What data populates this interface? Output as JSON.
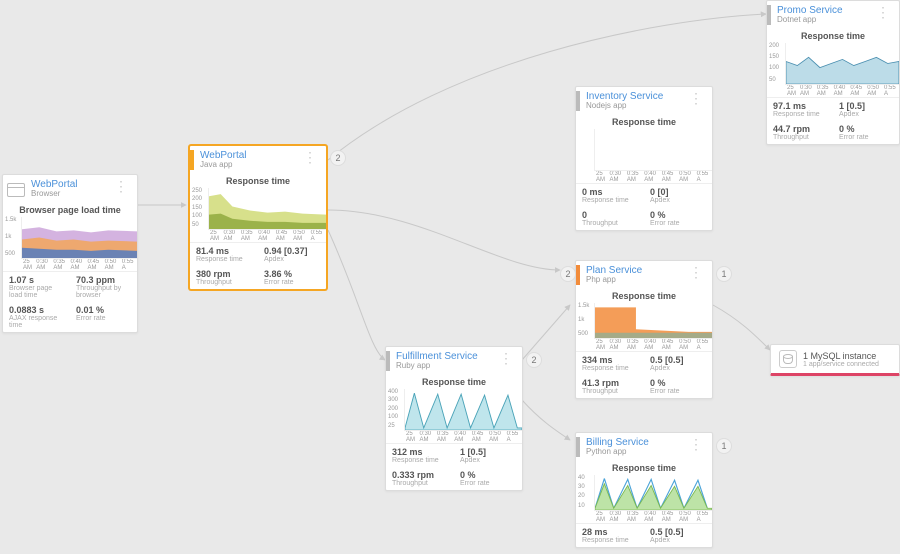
{
  "xaxis": [
    "25 AM",
    "0:30 AM",
    "0:35 AM",
    "0:40 AM",
    "0:45 AM",
    "0:50 AM",
    "0:55 A"
  ],
  "nodes": {
    "browser": {
      "title": "WebPortal",
      "subtitle": "Browser",
      "chart_title": "Browser page load time",
      "yticks": [
        "1.5k",
        "1k",
        "500"
      ],
      "metrics": [
        {
          "v": "1.07 s",
          "l": "Browser page load time"
        },
        {
          "v": "70.3 ppm",
          "l": "Throughput by browser"
        },
        {
          "v": "0.0883 s",
          "l": "AJAX response time"
        },
        {
          "v": "0.01 %",
          "l": "Error rate"
        }
      ]
    },
    "webportal": {
      "title": "WebPortal",
      "subtitle": "Java app",
      "chart_title": "Response time",
      "yticks": [
        "250",
        "200",
        "150",
        "100",
        "50"
      ],
      "metrics": [
        {
          "v": "81.4 ms",
          "l": "Response time"
        },
        {
          "v": "0.94 [0.37]",
          "l": "Apdex"
        },
        {
          "v": "380 rpm",
          "l": "Throughput"
        },
        {
          "v": "3.86 %",
          "l": "Error rate"
        }
      ],
      "badge": "2"
    },
    "fulfillment": {
      "title": "Fulfillment Service",
      "subtitle": "Ruby app",
      "chart_title": "Response time",
      "yticks": [
        "400",
        "300",
        "200",
        "100",
        "25"
      ],
      "metrics": [
        {
          "v": "312 ms",
          "l": "Response time"
        },
        {
          "v": "1 [0.5]",
          "l": "Apdex"
        },
        {
          "v": "0.333 rpm",
          "l": "Throughput"
        },
        {
          "v": "0 %",
          "l": "Error rate"
        }
      ],
      "badge": "2"
    },
    "inventory": {
      "title": "Inventory Service",
      "subtitle": "Nodejs app",
      "chart_title": "Response time",
      "metrics": [
        {
          "v": "0 ms",
          "l": "Response time"
        },
        {
          "v": "0 [0]",
          "l": "Apdex"
        },
        {
          "v": "0",
          "l": "Throughput"
        },
        {
          "v": "0 %",
          "l": "Error rate"
        }
      ]
    },
    "plan": {
      "title": "Plan Service",
      "subtitle": "Php app",
      "chart_title": "Response time",
      "yticks": [
        "1.5k",
        "1k",
        "500"
      ],
      "metrics": [
        {
          "v": "334 ms",
          "l": "Response time"
        },
        {
          "v": "0.5 [0.5]",
          "l": "Apdex"
        },
        {
          "v": "41.3 rpm",
          "l": "Throughput"
        },
        {
          "v": "0 %",
          "l": "Error rate"
        }
      ],
      "badge_left": "2",
      "badge_right": "1"
    },
    "billing": {
      "title": "Billing Service",
      "subtitle": "Python app",
      "chart_title": "Response time",
      "yticks": [
        "40",
        "30",
        "20",
        "10"
      ],
      "metrics": [
        {
          "v": "28 ms",
          "l": "Response time"
        },
        {
          "v": "0.5 [0.5]",
          "l": "Apdex"
        }
      ],
      "badge": "1"
    },
    "promo": {
      "title": "Promo Service",
      "subtitle": "Dotnet app",
      "chart_title": "Response time",
      "yticks": [
        "200",
        "150",
        "100",
        "50"
      ],
      "metrics": [
        {
          "v": "97.1 ms",
          "l": "Response time"
        },
        {
          "v": "1 [0.5]",
          "l": "Apdex"
        },
        {
          "v": "44.7 rpm",
          "l": "Throughput"
        },
        {
          "v": "0 %",
          "l": "Error rate"
        }
      ]
    },
    "mysql": {
      "title": "1 MySQL instance",
      "subtitle": "1 app/service connected"
    }
  },
  "chart_data": [
    {
      "node": "browser",
      "type": "area-stacked",
      "title": "Browser page load time",
      "ylim": [
        0,
        1500
      ],
      "x": [
        "0:25",
        "0:30",
        "0:35",
        "0:40",
        "0:45",
        "0:50",
        "0:55"
      ],
      "series": [
        {
          "name": "layer1",
          "values": [
            650,
            680,
            620,
            640,
            600,
            630,
            610
          ],
          "color": "#c9a0d8"
        },
        {
          "name": "layer2",
          "values": [
            400,
            420,
            380,
            390,
            370,
            380,
            360
          ],
          "color": "#f2a65a"
        },
        {
          "name": "layer3",
          "values": [
            250,
            240,
            230,
            220,
            210,
            220,
            210
          ],
          "color": "#5b7dbb"
        }
      ]
    },
    {
      "node": "webportal",
      "type": "area",
      "title": "Response time",
      "ylim": [
        0,
        250
      ],
      "x": [
        "0:25",
        "0:30",
        "0:35",
        "0:40",
        "0:45",
        "0:50",
        "0:55"
      ],
      "series": [
        {
          "name": "p95",
          "values": [
            200,
            210,
            140,
            120,
            110,
            115,
            100
          ],
          "color": "#d7e08b"
        },
        {
          "name": "mean",
          "values": [
            80,
            85,
            60,
            55,
            50,
            50,
            48
          ],
          "color": "#9bb24a"
        }
      ]
    },
    {
      "node": "fulfillment",
      "type": "line-spikes",
      "title": "Response time",
      "ylim": [
        0,
        400
      ],
      "x": [
        "0:25",
        "0:30",
        "0:35",
        "0:40",
        "0:45",
        "0:50",
        "0:55"
      ],
      "series": [
        {
          "name": "resp",
          "values": [
            30,
            380,
            30,
            370,
            30,
            360,
            30
          ],
          "color": "#76c7d6"
        }
      ]
    },
    {
      "node": "inventory",
      "type": "flat",
      "title": "Response time",
      "ylim": [
        0,
        1
      ],
      "x": [
        "0:25",
        "0:30",
        "0:35",
        "0:40",
        "0:45",
        "0:50",
        "0:55"
      ],
      "series": [
        {
          "name": "resp",
          "values": [
            0,
            0,
            0,
            0,
            0,
            0,
            0
          ]
        }
      ]
    },
    {
      "node": "plan",
      "type": "area-step",
      "title": "Response time",
      "ylim": [
        0,
        1500
      ],
      "x": [
        "0:25",
        "0:30",
        "0:35",
        "0:40",
        "0:45",
        "0:50",
        "0:55"
      ],
      "series": [
        {
          "name": "resp",
          "values": [
            1300,
            1300,
            1300,
            300,
            280,
            260,
            250
          ],
          "color": "#f28c3b"
        },
        {
          "name": "baseline",
          "values": [
            200,
            200,
            200,
            200,
            200,
            200,
            200
          ],
          "color": "#6fb4a8"
        }
      ]
    },
    {
      "node": "billing",
      "type": "line-spikes",
      "title": "Response time",
      "ylim": [
        0,
        40
      ],
      "x": [
        "0:25",
        "0:30",
        "0:35",
        "0:40",
        "0:45",
        "0:50",
        "0:55"
      ],
      "series": [
        {
          "name": "a",
          "values": [
            2,
            38,
            2,
            36,
            2,
            37,
            2
          ],
          "color": "#4aa3d8"
        },
        {
          "name": "b",
          "values": [
            2,
            32,
            2,
            30,
            2,
            31,
            2
          ],
          "color": "#8bc34a"
        }
      ]
    },
    {
      "node": "promo",
      "type": "area",
      "title": "Response time",
      "ylim": [
        0,
        200
      ],
      "x": [
        "0:25",
        "0:30",
        "0:35",
        "0:40",
        "0:45",
        "0:50",
        "0:55"
      ],
      "series": [
        {
          "name": "resp",
          "values": [
            110,
            95,
            120,
            90,
            105,
            115,
            100
          ],
          "color": "#6aa9c4"
        }
      ]
    }
  ]
}
